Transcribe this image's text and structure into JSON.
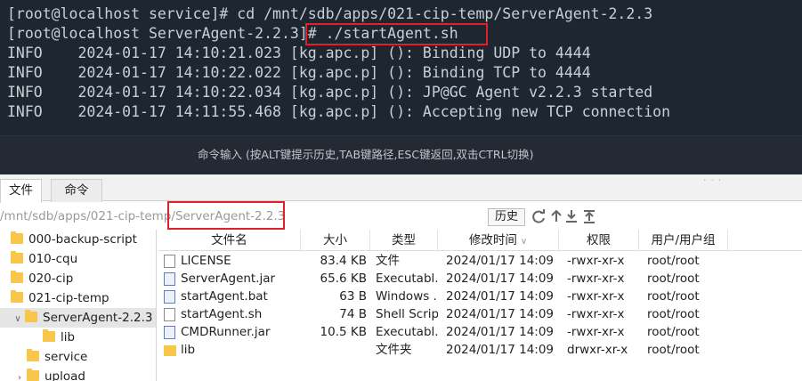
{
  "terminal": {
    "lines": [
      "[root@localhost service]# cd /mnt/sdb/apps/021-cip-temp/ServerAgent-2.2.3",
      "[root@localhost ServerAgent-2.2.3]# ./startAgent.sh",
      "INFO    2024-01-17 14:10:21.023 [kg.apc.p] (): Binding UDP to 4444",
      "INFO    2024-01-17 14:10:22.022 [kg.apc.p] (): Binding TCP to 4444",
      "INFO    2024-01-17 14:10:22.034 [kg.apc.p] (): JP@GC Agent v2.2.3 started",
      "INFO    2024-01-17 14:11:55.468 [kg.apc.p] (): Accepting new TCP connection"
    ],
    "command_hint": "命令输入 (按ALT键提示历史,TAB键路径,ESC键返回,双击CTRL切换)"
  },
  "tabs": [
    "文件",
    "命令"
  ],
  "path": {
    "prefix": "/mnt/sdb/apps/021-cip-temp/",
    "current": "ServerAgent-2.2.3",
    "history_label": "历史"
  },
  "tree": [
    {
      "label": "000-backup-script"
    },
    {
      "label": "010-cqu"
    },
    {
      "label": "020-cip"
    },
    {
      "label": "021-cip-temp"
    },
    {
      "label": "ServerAgent-2.2.3"
    },
    {
      "label": "lib"
    },
    {
      "label": "service"
    },
    {
      "label": "upload"
    }
  ],
  "table": {
    "headers": [
      "文件名",
      "大小",
      "类型",
      "修改时间",
      "权限",
      "用户/用户组"
    ],
    "rows": [
      {
        "name": "LICENSE",
        "size": "83.4 KB",
        "type": "文件",
        "mtime": "2024/01/17 14:09",
        "perm": "-rwxr-xr-x",
        "owner": "root/root",
        "icon": "file"
      },
      {
        "name": "ServerAgent.jar",
        "size": "65.6 KB",
        "type": "Executabl...",
        "mtime": "2024/01/17 14:09",
        "perm": "-rwxr-xr-x",
        "owner": "root/root",
        "icon": "jar"
      },
      {
        "name": "startAgent.bat",
        "size": "63 B",
        "type": "Windows ...",
        "mtime": "2024/01/17 14:09",
        "perm": "-rwxr-xr-x",
        "owner": "root/root",
        "icon": "bat"
      },
      {
        "name": "startAgent.sh",
        "size": "74 B",
        "type": "Shell Script",
        "mtime": "2024/01/17 14:09",
        "perm": "-rwxr-xr-x",
        "owner": "root/root",
        "icon": "file"
      },
      {
        "name": "CMDRunner.jar",
        "size": "10.5 KB",
        "type": "Executabl...",
        "mtime": "2024/01/17 14:09",
        "perm": "-rwxr-xr-x",
        "owner": "root/root",
        "icon": "jar"
      },
      {
        "name": "lib",
        "size": "",
        "type": "文件夹",
        "mtime": "2024/01/17 14:09",
        "perm": "drwxr-xr-x",
        "owner": "root/root",
        "icon": "dir"
      }
    ]
  },
  "colors": {
    "terminal_bg": "#1e2630",
    "terminal_text": "#c9cfd6",
    "highlight": "#e0212b",
    "folder": "#f7c64a"
  }
}
